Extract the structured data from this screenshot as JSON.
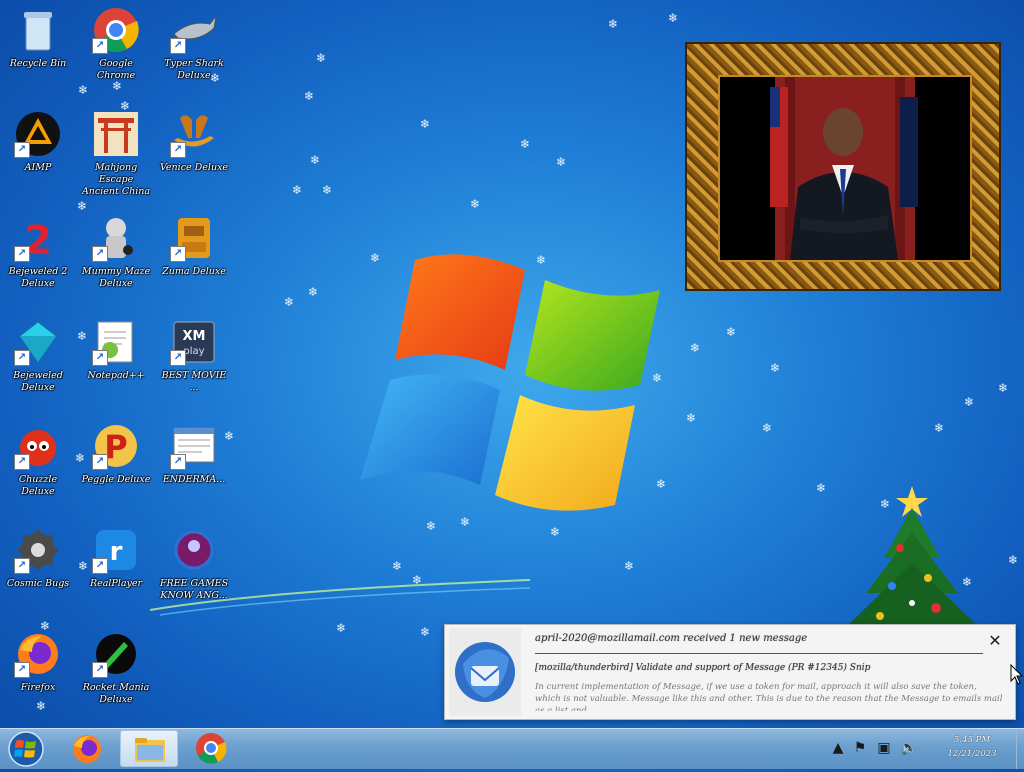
{
  "desktop_icons": [
    {
      "id": "recycle-bin",
      "label": "Recycle Bin",
      "icon": "recycle-bin-icon",
      "shortcut": false
    },
    {
      "id": "google-chrome",
      "label": "Google Chrome",
      "icon": "chrome-icon",
      "shortcut": true
    },
    {
      "id": "typer-shark",
      "label": "Typer Shark Deluxe",
      "icon": "shark-icon",
      "shortcut": true
    },
    {
      "id": "aimp",
      "label": "AIMP",
      "icon": "aimp-icon",
      "shortcut": true
    },
    {
      "id": "mahjong-escape",
      "label": "Mahjong Escape Ancient China",
      "icon": "torii-gate-icon",
      "shortcut": false
    },
    {
      "id": "venice",
      "label": "Venice Deluxe",
      "icon": "gondola-icon",
      "shortcut": true
    },
    {
      "id": "bejeweled-2",
      "label": "Bejeweled 2 Deluxe",
      "icon": "number-two-icon",
      "shortcut": true
    },
    {
      "id": "mummy-maze",
      "label": "Mummy Maze Deluxe",
      "icon": "mummy-icon",
      "shortcut": true
    },
    {
      "id": "zuma",
      "label": "Zuma Deluxe",
      "icon": "zuma-idol-icon",
      "shortcut": true
    },
    {
      "id": "bejeweled",
      "label": "Bejeweled Deluxe",
      "icon": "diamond-icon",
      "shortcut": true
    },
    {
      "id": "notepad",
      "label": "Notepad++",
      "icon": "notepad-icon",
      "shortcut": true
    },
    {
      "id": "xmplay",
      "label": "BEST MOVIE ...",
      "icon": "xmplay-icon",
      "shortcut": true
    },
    {
      "id": "chuzzle",
      "label": "Chuzzle Deluxe",
      "icon": "chuzzle-icon",
      "shortcut": true
    },
    {
      "id": "peggle",
      "label": "Peggle Deluxe",
      "icon": "peggle-icon",
      "shortcut": true
    },
    {
      "id": "info-window",
      "label": "ENDERMA...",
      "icon": "window-app-icon",
      "shortcut": true
    },
    {
      "id": "gear-app",
      "label": "Cosmic Bugs",
      "icon": "gear-icon",
      "shortcut": true
    },
    {
      "id": "realplayer",
      "label": "RealPlayer",
      "icon": "realplayer-icon",
      "shortcut": true
    },
    {
      "id": "free-games",
      "label": "FREE GAMES KNOW ANG...",
      "icon": "globe-robot-icon",
      "shortcut": false
    },
    {
      "id": "firefox",
      "label": "Firefox",
      "icon": "firefox-icon",
      "shortcut": true
    },
    {
      "id": "rocket-mania",
      "label": "Rocket Mania Deluxe",
      "icon": "rocket-icon",
      "shortcut": true
    }
  ],
  "notification": {
    "title": "april-2020@mozillamail.com received 1 new message",
    "subject": "[mozilla/thunderbird] Validate and support of Message (PR #12345)   Snip",
    "body": "In current implementation of Message, if we use a token for mail, approach it will also save the token, which is not valuable. Message like this and other. This is due to the reason that the Message to emails mail as a list and.",
    "close_label": "✕",
    "icon": "thunderbird-icon"
  },
  "taskbar": {
    "start_icon": "windows-start-icon",
    "items": [
      {
        "name": "taskbar-firefox",
        "icon": "firefox-icon",
        "active": false
      },
      {
        "name": "taskbar-file-explorer",
        "icon": "folder-icon",
        "active": true
      },
      {
        "name": "taskbar-chrome",
        "icon": "chrome-icon",
        "active": false
      }
    ],
    "tray": {
      "show_hidden_label": "▲",
      "clock_time": "5:45 PM",
      "clock_date": "12/21/2023"
    }
  },
  "colors": {
    "desktop_blue": "#1f7fd6",
    "taskbar_blue": "#6a9fce",
    "frame_gold": "#d39b33"
  }
}
